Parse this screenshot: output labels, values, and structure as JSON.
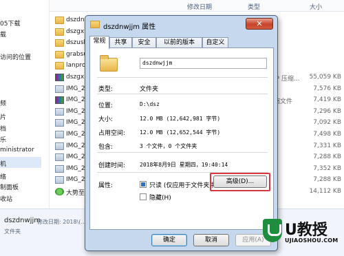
{
  "explorer": {
    "columns": {
      "modified": "修改日期",
      "type": "类型",
      "size": "大小"
    },
    "nav_items": [
      "05下载",
      "载",
      "访问的位置",
      "",
      "",
      "",
      "",
      "",
      "频",
      "片",
      "档",
      "乐",
      "ministrator",
      "机",
      "络",
      "制面板",
      "收站"
    ],
    "files": [
      {
        "icon": "folder-icon",
        "name": "dszdnw",
        "type": "",
        "size": ""
      },
      {
        "icon": "folder-icon",
        "name": "dszgx",
        "type": "",
        "size": ""
      },
      {
        "icon": "folder-icon",
        "name": "dszusb",
        "type": "",
        "size": ""
      },
      {
        "icon": "folder-icon",
        "name": "grabsu",
        "type": "",
        "size": ""
      },
      {
        "icon": "folder-icon",
        "name": "lanprot",
        "type": "",
        "size": ""
      },
      {
        "icon": "rar-icon",
        "name": "dszgx",
        "type": "IP 压缩...",
        "size": "55,059 KB"
      },
      {
        "icon": "image-icon",
        "name": "IMG_20",
        "type": "",
        "size": "7,576 KB"
      },
      {
        "icon": "rar-icon",
        "name": "IMG_20",
        "type": "缩文件",
        "size": "7,419 KB"
      },
      {
        "icon": "image-icon",
        "name": "IMG_20",
        "type": "",
        "size": "7,296 KB"
      },
      {
        "icon": "image-icon",
        "name": "IMG_20",
        "type": "",
        "size": "7,092 KB"
      },
      {
        "icon": "image-icon",
        "name": "IMG_20",
        "type": "",
        "size": "7,498 KB"
      },
      {
        "icon": "image-icon",
        "name": "IMG_20",
        "type": "",
        "size": "7,331 KB"
      },
      {
        "icon": "image-icon",
        "name": "IMG_20",
        "type": "",
        "size": "7,288 KB"
      },
      {
        "icon": "image-icon",
        "name": "IMG_20",
        "type": "",
        "size": "7,352 KB"
      },
      {
        "icon": "image-icon",
        "name": "IMG_20",
        "type": "",
        "size": "7,288 KB"
      },
      {
        "icon": "app-icon",
        "name": "大势至电",
        "type": "",
        "size": "14,112 KB"
      }
    ],
    "details": {
      "name": "dszdnwjjm",
      "meta": "修改日期: 2018\\(...)",
      "type": "文件夹"
    }
  },
  "dialog": {
    "title": "dszdnwjjm 属性",
    "close": "✕",
    "tabs": [
      "常规",
      "共享",
      "安全",
      "以前的版本",
      "自定义"
    ],
    "folder_name": "dszdnwjjm",
    "props": {
      "type_label": "类型:",
      "type_value": "文件夹",
      "location_label": "位置:",
      "location_value": "D:\\dsz",
      "size_label": "大小:",
      "size_value": "12.0 MB (12,642,981 字节)",
      "disk_label": "占用空间:",
      "disk_value": "12.0 MB (12,652,544 字节)",
      "contains_label": "包含:",
      "contains_value": "3 个文件，0 个文件夹",
      "created_label": "创建时间:",
      "created_value": "2018年8月9日 星期四，19:40:14",
      "attr_label": "属性:",
      "readonly": "只读 (仅应用于文件夹中的文件)(R)",
      "hidden": "隐藏(H)",
      "advanced": "高级(D)..."
    },
    "buttons": {
      "ok": "确定",
      "cancel": "取消",
      "apply": "应用(A)"
    }
  },
  "watermark": {
    "brand": "U教授",
    "url": "UJIAOSHOU.COM"
  }
}
